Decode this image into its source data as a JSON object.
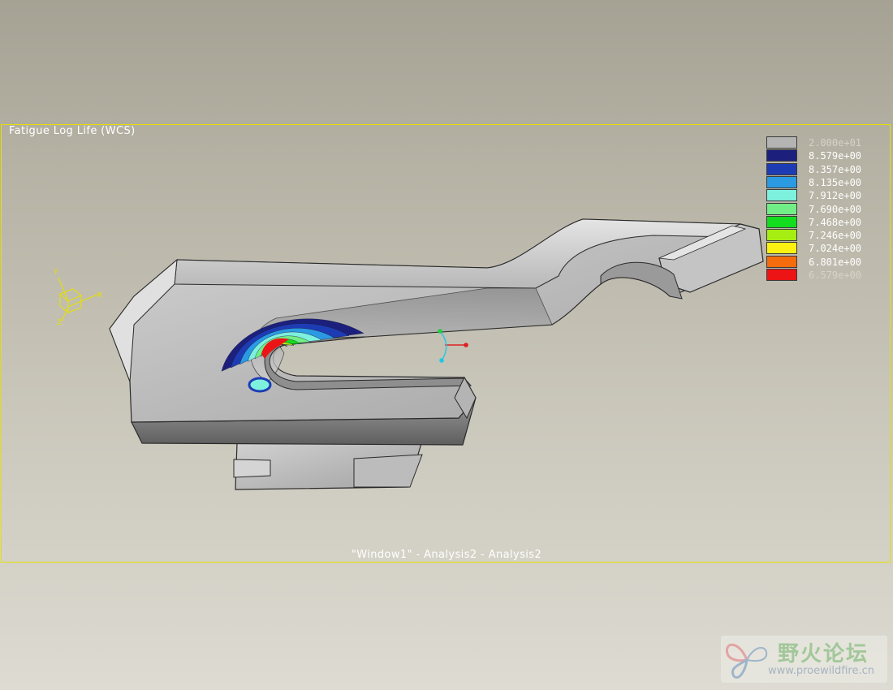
{
  "viewport": {
    "result_title": "Fatigue Log Life (WCS)",
    "window_caption": "\"Window1\" - Analysis2 - Analysis2"
  },
  "legend": {
    "entries": [
      {
        "value": "2.000e+01",
        "color": "#b4b4b4"
      },
      {
        "value": "8.579e+00",
        "color": "#1c207c"
      },
      {
        "value": "8.357e+00",
        "color": "#1d3cb4"
      },
      {
        "value": "8.135e+00",
        "color": "#2b9ae2"
      },
      {
        "value": "7.912e+00",
        "color": "#7ef0de"
      },
      {
        "value": "7.690e+00",
        "color": "#72ee86"
      },
      {
        "value": "7.468e+00",
        "color": "#14dc1e"
      },
      {
        "value": "7.246e+00",
        "color": "#a6ee12"
      },
      {
        "value": "7.024e+00",
        "color": "#fcf212"
      },
      {
        "value": "6.801e+00",
        "color": "#f46c0c"
      },
      {
        "value": "6.579e+00",
        "color": "#ec1414"
      }
    ]
  },
  "triad": {
    "x_label": "X",
    "y_label": "Y",
    "z_label": "Z"
  },
  "watermark": {
    "title": "野火论坛",
    "url": "www.proewildfire.cn"
  }
}
